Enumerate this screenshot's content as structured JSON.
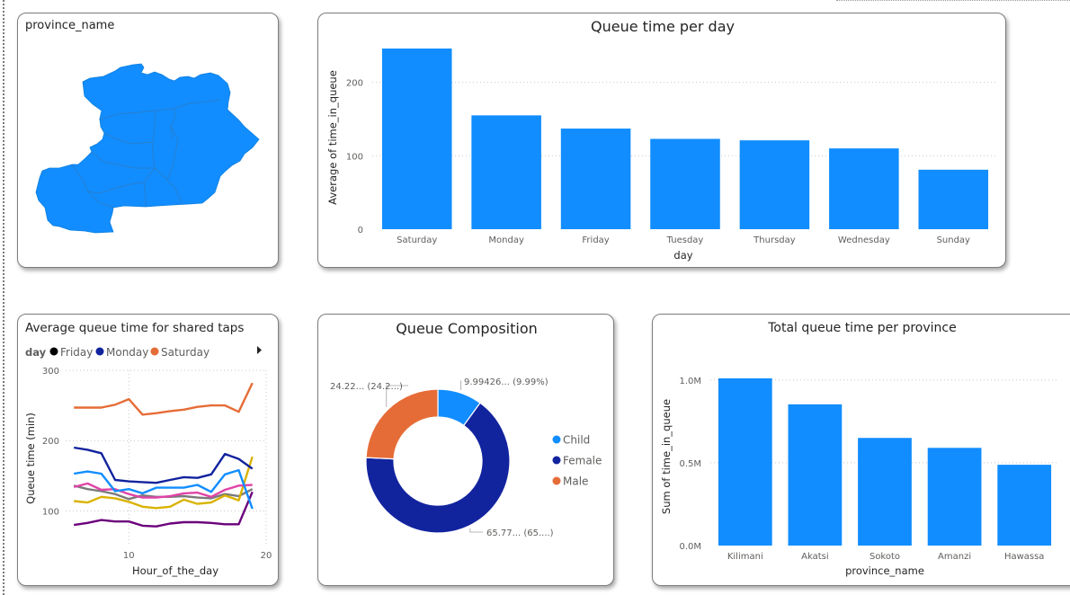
{
  "colors": {
    "blue": "#118DFF",
    "dark_blue": "#12239E",
    "orange": "#E66C37",
    "purple": "#6B007B",
    "magenta": "#E044A7",
    "yellow": "#D9B300",
    "grid": "#C8C8C8"
  },
  "map_card": {
    "title": "province_name"
  },
  "chart_data": [
    {
      "id": "queue_per_day",
      "type": "bar",
      "title": "Queue time per day",
      "xlabel": "day",
      "ylabel": "Average of time_in_queue",
      "categories": [
        "Saturday",
        "Monday",
        "Friday",
        "Tuesday",
        "Thursday",
        "Wednesday",
        "Sunday"
      ],
      "values": [
        246,
        155,
        137,
        123,
        121,
        110,
        81
      ],
      "ylim": [
        0,
        246
      ],
      "yticks": [
        0,
        100,
        200
      ],
      "grid": true
    },
    {
      "id": "shared_taps",
      "type": "line",
      "title": "Average queue time for shared taps",
      "xlabel": "Hour_of_the_day",
      "ylabel": "Queue time (min)",
      "legend_title": "day",
      "legend": [
        "Friday",
        "Monday",
        "Saturday"
      ],
      "x": [
        6,
        7,
        8,
        9,
        10,
        11,
        12,
        13,
        14,
        15,
        16,
        17,
        18,
        19
      ],
      "xlim": [
        5.4,
        20
      ],
      "xticks": [
        10,
        20
      ],
      "ylim": [
        52,
        300
      ],
      "yticks": [
        100,
        200,
        300
      ],
      "series": [
        {
          "name": "Saturday",
          "color": "#E66C37",
          "values": [
            247,
            247,
            247,
            251,
            259,
            237,
            239,
            242,
            244,
            248,
            250,
            250,
            241,
            282
          ]
        },
        {
          "name": "Monday",
          "color": "#12239E",
          "values": [
            190,
            187,
            182,
            144,
            142,
            141,
            140,
            144,
            148,
            147,
            152,
            181,
            174,
            160
          ]
        },
        {
          "color": "#118DFF",
          "values": [
            153,
            156,
            153,
            128,
            131,
            125,
            133,
            133,
            133,
            137,
            127,
            152,
            158,
            103
          ]
        },
        {
          "color": "#E044A7",
          "values": [
            134,
            139,
            130,
            131,
            124,
            119,
            119,
            121,
            125,
            126,
            120,
            130,
            136,
            137
          ]
        },
        {
          "color": "#D9B300",
          "values": [
            114,
            112,
            120,
            118,
            113,
            106,
            104,
            106,
            116,
            110,
            112,
            122,
            115,
            177
          ]
        },
        {
          "color": "#7A7A7A",
          "values": [
            136,
            131,
            128,
            124,
            117,
            122,
            120,
            120,
            121,
            119,
            118,
            124,
            121,
            131
          ]
        },
        {
          "color": "#6B007B",
          "values": [
            80,
            83,
            87,
            85,
            85,
            79,
            78,
            82,
            84,
            84,
            83,
            81,
            81,
            127
          ]
        }
      ]
    },
    {
      "id": "queue_composition",
      "type": "pie",
      "title": "Queue Composition",
      "categories": [
        "Child",
        "Female",
        "Male"
      ],
      "values": [
        9.99,
        65.77,
        24.22
      ],
      "colors": [
        "#118DFF",
        "#12239E",
        "#E66C37"
      ],
      "data_labels": [
        "9.99426... (9.99%)",
        "65.77... (65....)",
        "24.22... (24.2...)"
      ]
    },
    {
      "id": "queue_per_province",
      "type": "bar",
      "title": "Total queue time per province",
      "xlabel": "province_name",
      "ylabel": "Sum of time_in_queue",
      "categories": [
        "Kilimani",
        "Akatsi",
        "Sokoto",
        "Amanzi",
        "Hawassa"
      ],
      "values": [
        1.01,
        0.853,
        0.65,
        0.59,
        0.488
      ],
      "ylim": [
        0,
        1.015
      ],
      "yticks": [
        0,
        0.5,
        1.0
      ],
      "ytick_labels": [
        "0.0M",
        "0.5M",
        "1.0M"
      ],
      "grid": true
    }
  ]
}
